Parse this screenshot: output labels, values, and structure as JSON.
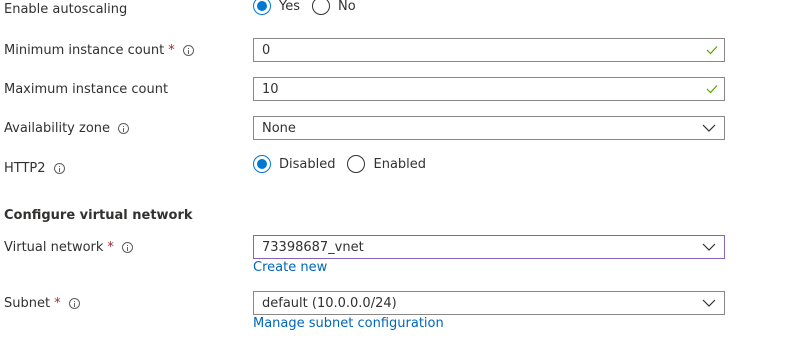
{
  "autoscaling": {
    "label": "Enable autoscaling",
    "options": [
      "Yes",
      "No"
    ],
    "selected": "Yes"
  },
  "min_instance": {
    "label": "Minimum instance count",
    "required_mark": "*",
    "value": "0"
  },
  "max_instance": {
    "label": "Maximum instance count",
    "value": "10"
  },
  "availability_zone": {
    "label": "Availability zone",
    "value": "None"
  },
  "http2": {
    "label": "HTTP2",
    "options": [
      "Disabled",
      "Enabled"
    ],
    "selected": "Disabled"
  },
  "vnet_section": {
    "title": "Configure virtual network"
  },
  "virtual_network": {
    "label": "Virtual network",
    "required_mark": "*",
    "value": "73398687_vnet",
    "link": "Create new"
  },
  "subnet": {
    "label": "Subnet",
    "required_mark": "*",
    "value": "default (10.0.0.0/24)",
    "link": "Manage subnet configuration"
  },
  "colors": {
    "accent": "#0078d4",
    "link": "#0067b8",
    "valid_check": "#57a300",
    "required": "#a4262c",
    "focus_border": "#8764b8"
  }
}
